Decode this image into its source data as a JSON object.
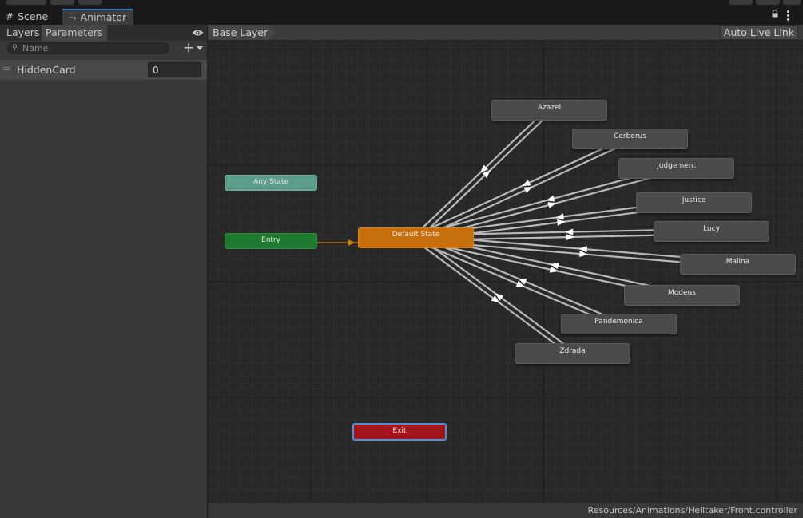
{
  "window": {
    "tabs": [
      {
        "label": "Scene",
        "icon": "grid-icon"
      },
      {
        "label": "Animator",
        "icon": "animator-icon",
        "active": true
      }
    ]
  },
  "left_panel": {
    "tabs": [
      {
        "label": "Layers"
      },
      {
        "label": "Parameters",
        "selected": true
      }
    ],
    "search_placeholder": "Name",
    "parameters": [
      {
        "name": "HiddenCard",
        "value": "0"
      }
    ]
  },
  "graph": {
    "breadcrumb": "Base Layer",
    "auto_live_link": "Auto Live Link",
    "states": {
      "any_state": "Any State",
      "entry": "Entry",
      "default": "Default State",
      "exit": "Exit",
      "azazel": "Azazel",
      "cerberus": "Cerberus",
      "judgement": "Judgement",
      "justice": "Justice",
      "lucy": "Lucy",
      "malina": "Malina",
      "modeus": "Modeus",
      "pandemonica": "Pandemonica",
      "zdrada": "Zdrada"
    },
    "colors": {
      "any_state": "#5e9c8c",
      "entry": "#1e7a2e",
      "default": "#c76f0d",
      "exit": "#a5161b",
      "state": "#4a4a4a",
      "transition": "#b9b9b9",
      "entry_transition": "#8a5a1a"
    }
  },
  "status": {
    "path": "Resources/Animations/Helltaker/Front.controller"
  }
}
